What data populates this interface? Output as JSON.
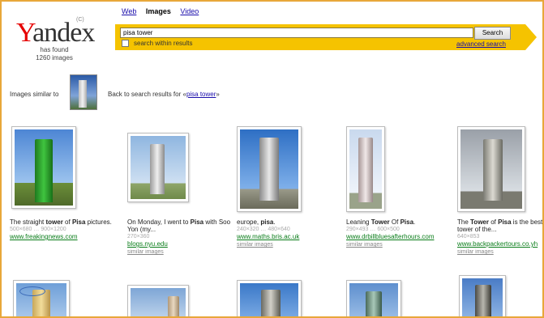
{
  "logo": {
    "text_y": "Y",
    "text_rest": "andex",
    "tm": "(C)"
  },
  "found": {
    "line1": "has found",
    "line2": "1260 images"
  },
  "tabs": [
    {
      "label": "Web",
      "active": false
    },
    {
      "label": "Images",
      "active": true
    },
    {
      "label": "Video",
      "active": false
    }
  ],
  "search": {
    "query": "pisa tower",
    "button_label": "Search",
    "within_label": "search within results",
    "advanced_label": "advanced search"
  },
  "similar": {
    "label": "Images similar to",
    "back_prefix": "Back to search results for «",
    "back_query": "pisa tower",
    "back_suffix": "»"
  },
  "results": [
    {
      "caption_pre": "The straight ",
      "caption_b1": "tower",
      "caption_mid": " of ",
      "caption_b2": "Pisa",
      "caption_post": " pictures.",
      "size": "500×680 … 900×1200",
      "url": "www.freakingnews.com",
      "similar": ""
    },
    {
      "caption_pre": "On Monday, I went to ",
      "caption_b1": "Pisa",
      "caption_mid": "",
      "caption_b2": "",
      "caption_post": " with Soo Yon (my...",
      "size": "270×360",
      "url": "blogs.nyu.edu",
      "similar": "similar images"
    },
    {
      "caption_pre": "europe, ",
      "caption_b1": "pisa",
      "caption_mid": ".",
      "caption_b2": "",
      "caption_post": "",
      "size": "240×320 … 480×640",
      "url": "www.maths.bris.ac.uk",
      "similar": "similar images"
    },
    {
      "caption_pre": "Leaning ",
      "caption_b1": "Tower",
      "caption_mid": " Of ",
      "caption_b2": "Pisa",
      "caption_post": ".",
      "size": "290×493 … 600×500",
      "url": "www.drbillbluesafterhours.com",
      "similar": "similar images"
    },
    {
      "caption_pre": "The ",
      "caption_b1": "Tower",
      "caption_mid": " of ",
      "caption_b2": "Pisa",
      "caption_post": " is the best tower of the...",
      "size": "640×853",
      "url": "www.backpackertours.co.yh",
      "similar": "similar images"
    }
  ],
  "colors": {
    "search_band": "#f5c300",
    "frame": "#e8a73a",
    "link": "#1a0dab",
    "url_green": "#0a7d1a"
  }
}
